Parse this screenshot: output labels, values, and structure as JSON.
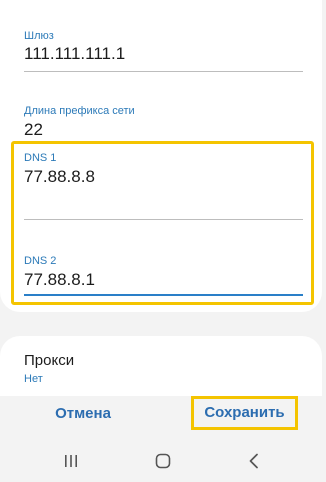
{
  "fields": {
    "gateway": {
      "label": "Шлюз",
      "value": "111.111.111.1"
    },
    "prefix": {
      "label": "Длина префикса сети",
      "value": "22"
    },
    "dns1": {
      "label": "DNS 1",
      "value": "77.88.8.8"
    },
    "dns2": {
      "label": "DNS 2",
      "value": "77.88.8.1"
    }
  },
  "proxy": {
    "title": "Прокси",
    "value": "Нет"
  },
  "actions": {
    "cancel": "Отмена",
    "save": "Сохранить"
  },
  "colors": {
    "accent": "#2c7ab8",
    "highlight": "#f4c400",
    "background": "#f3f3f3"
  },
  "navbar": {
    "icons": [
      "recent-apps-icon",
      "home-icon",
      "back-icon"
    ]
  }
}
